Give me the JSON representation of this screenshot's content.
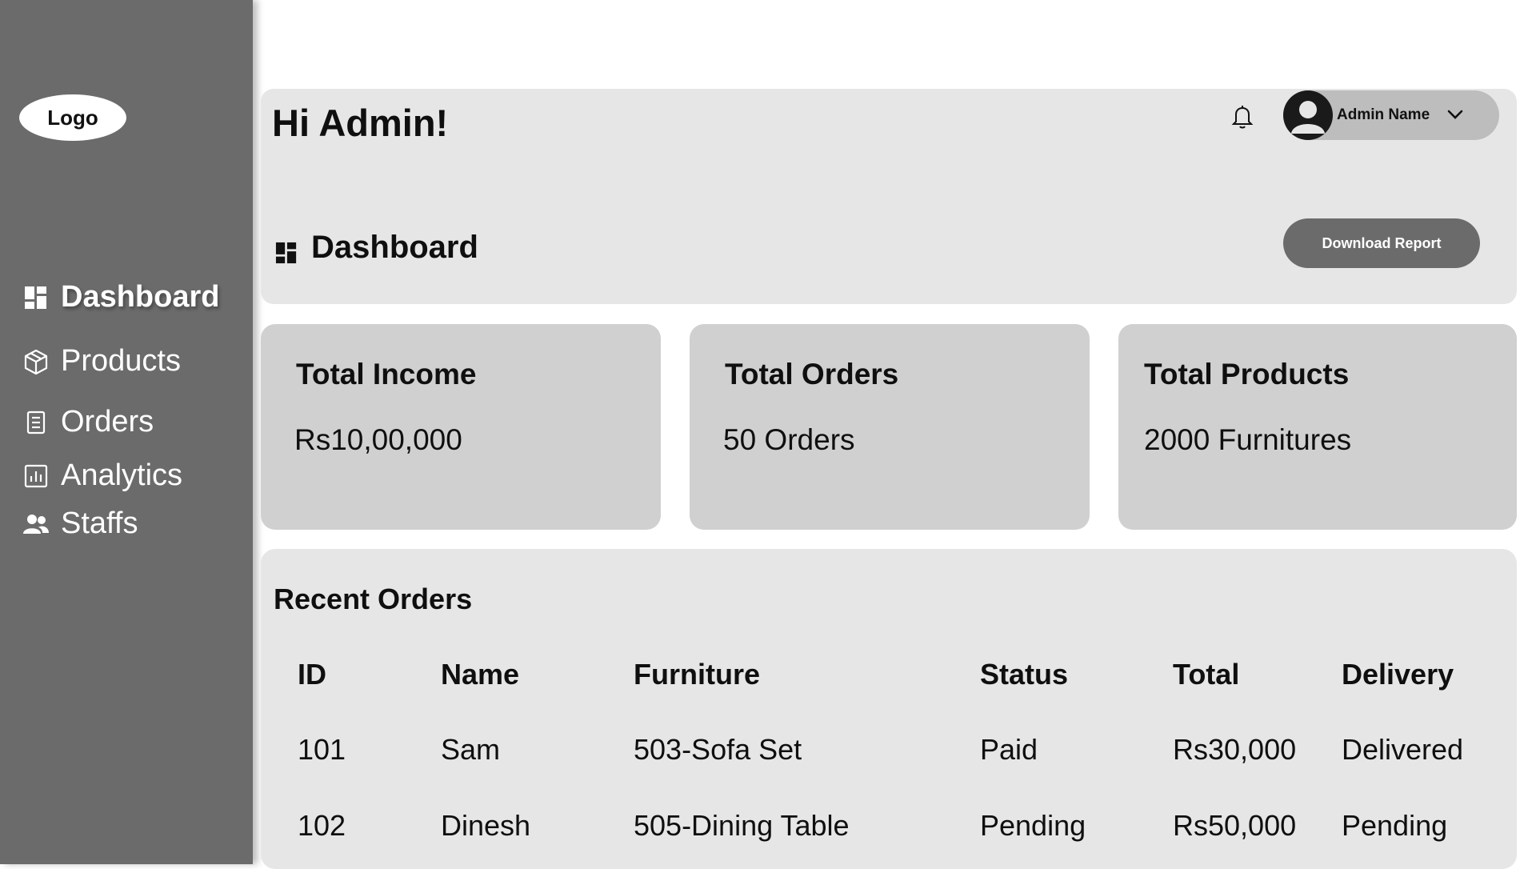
{
  "sidebar": {
    "logo": "Logo",
    "items": [
      {
        "label": "Dashboard",
        "icon": "dashboard-icon",
        "active": true
      },
      {
        "label": "Products",
        "icon": "box-icon"
      },
      {
        "label": "Orders",
        "icon": "document-icon"
      },
      {
        "label": "Analytics",
        "icon": "analytics-icon"
      },
      {
        "label": "Staffs",
        "icon": "people-icon"
      }
    ]
  },
  "header": {
    "greeting": "Hi Admin!",
    "user_name": "Admin Name",
    "section_title": "Dashboard",
    "download_label": "Download Report"
  },
  "cards": [
    {
      "title": "Total Income",
      "value": "Rs10,00,000"
    },
    {
      "title": "Total Orders",
      "value": "50 Orders"
    },
    {
      "title": "Total Products",
      "value": "2000 Furnitures"
    }
  ],
  "recent_orders": {
    "title": "Recent Orders",
    "columns": [
      "ID",
      "Name",
      "Furniture",
      "Status",
      "Total",
      "Delivery"
    ],
    "rows": [
      [
        "101",
        "Sam",
        "503-Sofa Set",
        "Paid",
        "Rs30,000",
        "Delivered"
      ],
      [
        "102",
        "Dinesh",
        "505-Dining Table",
        "Pending",
        "Rs50,000",
        "Pending"
      ]
    ]
  },
  "colors": {
    "sidebar": "#6b6b6b",
    "panel": "#e6e6e6",
    "card": "#d0d0d0",
    "button": "#6b6b6b"
  }
}
